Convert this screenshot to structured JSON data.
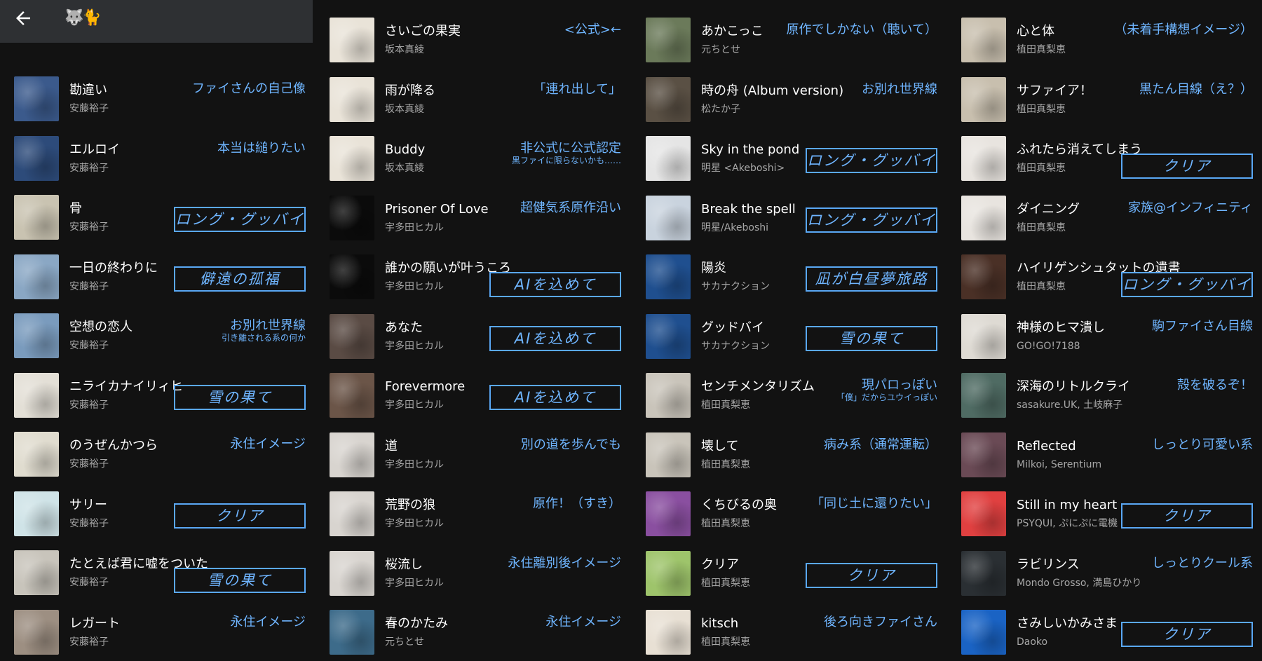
{
  "header": {
    "back_icon": "arrow-left-icon",
    "title": "🐺🐈"
  },
  "colors": {
    "background": "#121212",
    "accent": "#6fb5ff"
  },
  "columns": [
    {
      "tracks": [
        {
          "title": "勘違い",
          "artist": "安藤裕子",
          "note": "ファイさんの自己像",
          "boxed": false,
          "art": "#3b5a8c"
        },
        {
          "title": "エルロイ",
          "artist": "安藤裕子",
          "note": "本当は縋りたい",
          "boxed": false,
          "art": "#2d4b7a"
        },
        {
          "title": "骨",
          "artist": "安藤裕子",
          "note": "ロング・グッバイ",
          "boxed": true,
          "art": "#c9c3b1"
        },
        {
          "title": "一日の終わりに",
          "artist": "安藤裕子",
          "note": "僻遠の孤福",
          "boxed": true,
          "art": "#8aa7c4"
        },
        {
          "title": "空想の恋人",
          "artist": "安藤裕子",
          "note": "お別れ世界線",
          "sub": "引き離される系の何か",
          "boxed": false,
          "art": "#7a9bbd"
        },
        {
          "title": "ニライカナイリィヒ",
          "artist": "安藤裕子",
          "note": "雪の果て",
          "boxed": true,
          "art": "#e3dfd6"
        },
        {
          "title": "のうぜんかつら",
          "artist": "安藤裕子",
          "note": "永住イメージ",
          "boxed": false,
          "art": "#e0dccf"
        },
        {
          "title": "サリー",
          "artist": "安藤裕子",
          "note": "クリア",
          "boxed": true,
          "art": "#cfe3e7"
        },
        {
          "title": "たとえば君に嘘をついた",
          "artist": "安藤裕子",
          "note": "雪の果て",
          "boxed": true,
          "low": true,
          "art": "#c8c4bb"
        },
        {
          "title": "レガート",
          "artist": "安藤裕子",
          "note": "永住イメージ",
          "boxed": false,
          "art": "#9d8f82"
        }
      ]
    },
    {
      "tracks": [
        {
          "title": "さいごの果実",
          "artist": "坂本真綾",
          "note": "<公式>←",
          "boxed": false,
          "art": "#e9e3d8"
        },
        {
          "title": "雨が降る",
          "artist": "坂本真綾",
          "note": "「連れ出して」",
          "boxed": false,
          "art": "#e9e3d8"
        },
        {
          "title": "Buddy",
          "artist": "坂本真綾",
          "note": "非公式に公式認定",
          "sub": "黒ファイに限らないかも……",
          "boxed": false,
          "art": "#e9e3d8"
        },
        {
          "title": "Prisoner Of Love",
          "artist": "宇多田ヒカル",
          "note": "超健気系原作沿い",
          "boxed": false,
          "art": "#0b0b0b"
        },
        {
          "title": "誰かの願いが叶うころ",
          "artist": "宇多田ヒカル",
          "note": "AIを込めて",
          "boxed": true,
          "low": true,
          "art": "#0b0b0b"
        },
        {
          "title": "あなた",
          "artist": "宇多田ヒカル",
          "note": "AIを込めて",
          "boxed": true,
          "art": "#5a4b44"
        },
        {
          "title": "Forevermore",
          "artist": "宇多田ヒカル",
          "note": "AIを込めて",
          "boxed": true,
          "art": "#6b5548"
        },
        {
          "title": "道",
          "artist": "宇多田ヒカル",
          "note": "別の道を歩んでも",
          "boxed": false,
          "art": "#d8d4cf"
        },
        {
          "title": "荒野の狼",
          "artist": "宇多田ヒカル",
          "note": "原作！（すき）",
          "boxed": false,
          "art": "#d8d4cf"
        },
        {
          "title": "桜流し",
          "artist": "宇多田ヒカル",
          "note": "永住離別後イメージ",
          "boxed": false,
          "art": "#d8d4cf"
        },
        {
          "title": "春のかたみ",
          "artist": "元ちとせ",
          "note": "永住イメージ",
          "boxed": false,
          "art": "#3d6b8a"
        }
      ]
    },
    {
      "tracks": [
        {
          "title": "あかこっこ",
          "artist": "元ちとせ",
          "note": "原作でしかない（聴いて）",
          "boxed": false,
          "art": "#6b7a5a"
        },
        {
          "title": "時の舟 (Album version)",
          "artist": "松たか子",
          "note": "お別れ世界線",
          "boxed": false,
          "art": "#5a5044"
        },
        {
          "title": "Sky in the pond",
          "artist": "明星 <Akeboshi>",
          "note": "ロング・グッバイ",
          "boxed": true,
          "art": "#e5e5e5"
        },
        {
          "title": "Break the spell",
          "artist": "明星/Akeboshi",
          "note": "ロング・グッバイ",
          "boxed": true,
          "art": "#c9d3de"
        },
        {
          "title": "陽炎",
          "artist": "サカナクション",
          "note": "凪が白昼夢旅路",
          "boxed": true,
          "art": "#1f4f8f"
        },
        {
          "title": "グッドバイ",
          "artist": "サカナクション",
          "note": "雪の果て",
          "boxed": true,
          "art": "#1f4f8f"
        },
        {
          "title": "センチメンタリズム",
          "artist": "植田真梨恵",
          "note": "現パロっぽい",
          "sub": "「僕」だからユウイっぽい",
          "boxed": false,
          "art": "#c9c4ba"
        },
        {
          "title": "壊して",
          "artist": "植田真梨恵",
          "note": "病み系（通常運転）",
          "boxed": false,
          "art": "#c9c4ba"
        },
        {
          "title": "くちびるの奥",
          "artist": "植田真梨恵",
          "note": "「同じ土に還りたい」",
          "boxed": false,
          "art": "#8a4fa0"
        },
        {
          "title": "クリア",
          "artist": "植田真梨恵",
          "note": "クリア",
          "boxed": true,
          "art": "#9ec46b"
        },
        {
          "title": "kitsch",
          "artist": "植田真梨恵",
          "note": "後ろ向きファイさん",
          "boxed": false,
          "art": "#e8e0d4"
        }
      ]
    },
    {
      "tracks": [
        {
          "title": "心と体",
          "artist": "植田真梨恵",
          "note": "（未着手構想イメージ）",
          "boxed": false,
          "art": "#c8bfae"
        },
        {
          "title": "サファイア！",
          "artist": "植田真梨恵",
          "note": "黒たん目線（え？）",
          "boxed": false,
          "art": "#c8bfae"
        },
        {
          "title": "ふれたら消えてしまう",
          "artist": "植田真梨恵",
          "note": "クリア",
          "boxed": true,
          "low": true,
          "art": "#e8e4df"
        },
        {
          "title": "ダイニング",
          "artist": "植田真梨恵",
          "note": "家族@インフィニティ",
          "boxed": false,
          "art": "#e8e4df"
        },
        {
          "title": "ハイリゲンシュタットの遺書",
          "artist": "植田真梨恵",
          "note": "ロング・グッバイ",
          "boxed": true,
          "low": true,
          "art": "#4a3026"
        },
        {
          "title": "神様のヒマ潰し",
          "artist": "GO!GO!7188",
          "note": "駒ファイさん目線",
          "boxed": false,
          "art": "#dedad3"
        },
        {
          "title": "深海のリトルクライ",
          "artist": "sasakure.UK, 土岐麻子",
          "note": "殻を破るぞ！",
          "boxed": false,
          "art": "#4f6b63"
        },
        {
          "title": "Reflected",
          "artist": "Milkoi, Serentium",
          "note": "しっとり可愛い系",
          "boxed": false,
          "art": "#6a4a55"
        },
        {
          "title": "Still in my heart",
          "artist": "PSYQUI, ぷにぷに電機",
          "note": "クリア",
          "boxed": true,
          "art": "#e04040"
        },
        {
          "title": "ラビリンス",
          "artist": "Mondo Grosso, 満島ひかり",
          "note": "しっとりクール系",
          "boxed": false,
          "art": "#2a2f33"
        },
        {
          "title": "さみしいかみさま",
          "artist": "Daoko",
          "note": "クリア",
          "boxed": true,
          "art": "#1a63c4"
        }
      ]
    }
  ]
}
